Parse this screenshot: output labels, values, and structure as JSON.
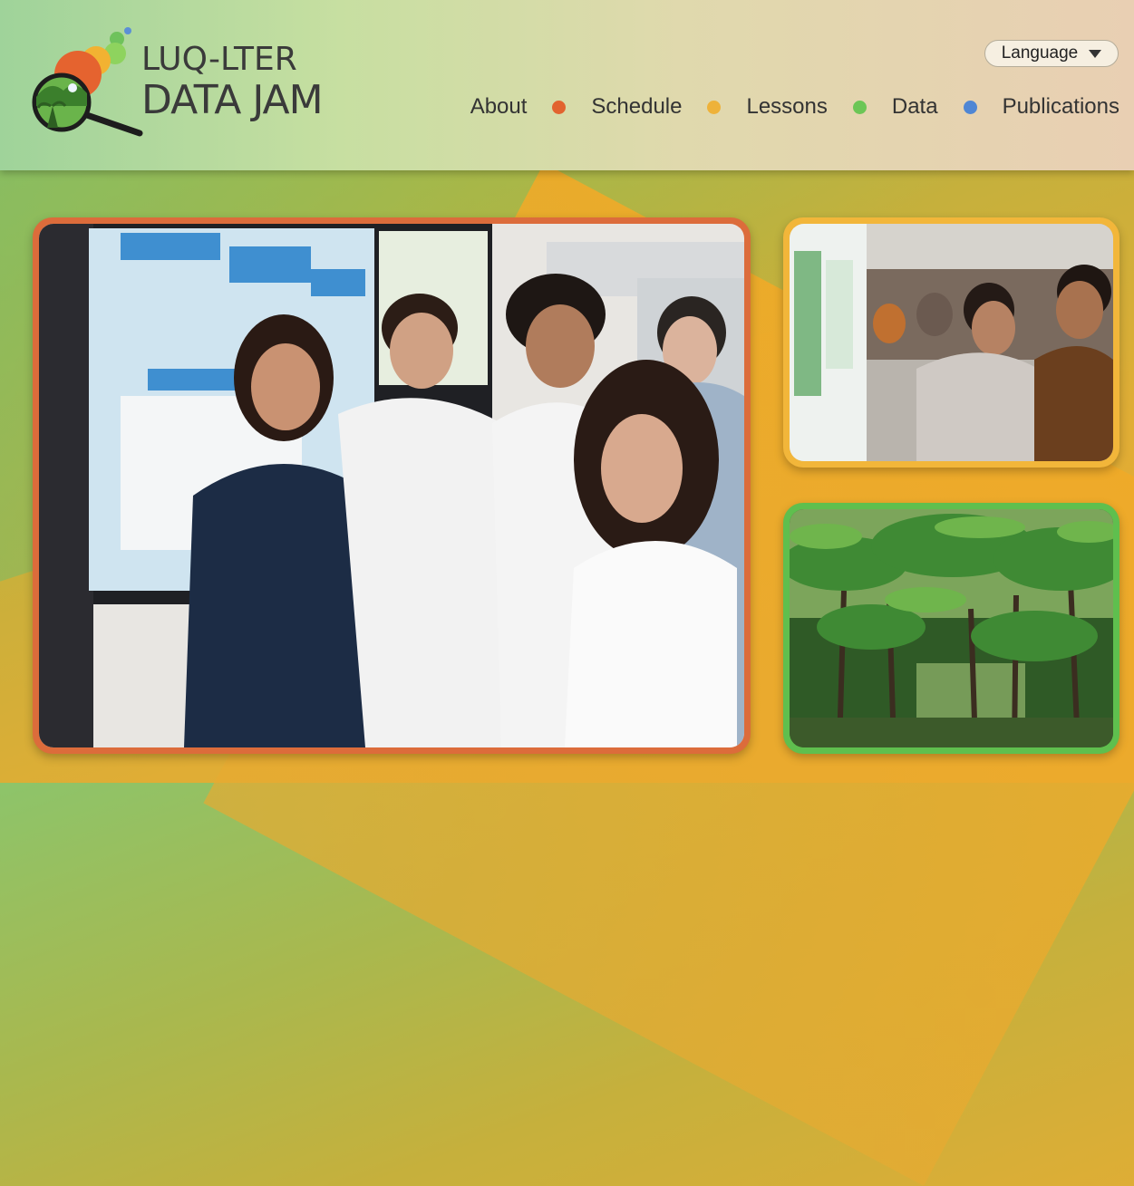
{
  "logo": {
    "line1": "LUQ-LTER",
    "line2": "DATA JAM",
    "icon": "magnifying-glass-forest-logo"
  },
  "language": {
    "label": "Language",
    "icon": "caret-down-icon"
  },
  "nav": {
    "items": [
      {
        "label": "About",
        "dot_color": "#e2632f"
      },
      {
        "label": "Schedule",
        "dot_color": "#eeb23a"
      },
      {
        "label": "Lessons",
        "dot_color": "#6cc656"
      },
      {
        "label": "Data",
        "dot_color": "#4f86d4"
      },
      {
        "label": "Publications"
      }
    ]
  },
  "photos": {
    "main": {
      "frame_color": "#dc6c3b",
      "subject": "students at poster session"
    },
    "top_right": {
      "frame_color": "#f2b63a",
      "subject": "students discussing posters"
    },
    "bottom_right": {
      "frame_color": "#5fbf4e",
      "subject": "tropical rainforest palms"
    }
  }
}
